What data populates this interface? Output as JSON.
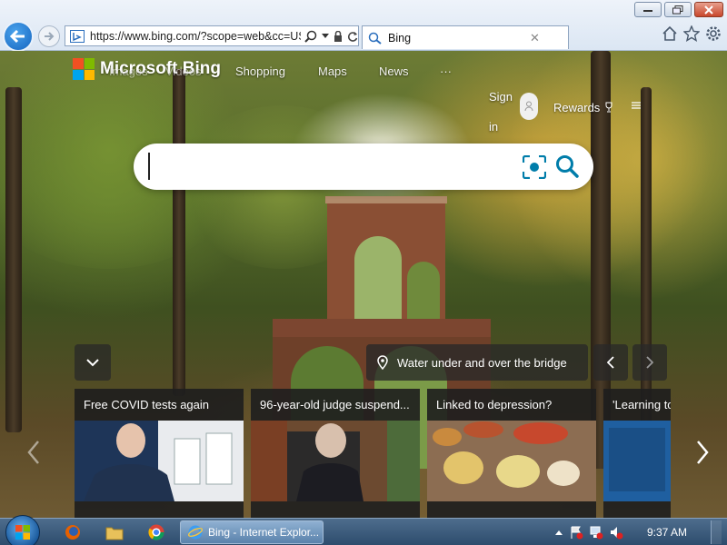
{
  "browser": {
    "url": "https://www.bing.com/?scope=web&cc=US&toHttps=1&redig=",
    "tab_title": "Bing",
    "tab_close": "✕"
  },
  "bing": {
    "logo_text": "Microsoft Bing",
    "nav": [
      "Images",
      "Videos",
      "Shopping",
      "Maps",
      "News",
      "···"
    ],
    "sign_in": "Sign in",
    "rewards": "Rewards",
    "search_placeholder": "",
    "image_caption": "Water under and over the bridge",
    "cards": [
      {
        "title": "Free COVID tests again"
      },
      {
        "title": "96-year-old judge suspend..."
      },
      {
        "title": "Linked to depression?"
      },
      {
        "title": "'Learning to"
      }
    ]
  },
  "taskbar": {
    "active_window": "Bing - Internet Explor...",
    "clock": "9:37 AM"
  },
  "colors": {
    "ie_blue": "#1565c0",
    "bing_accent": "#007daa",
    "taskbar": "#2d4c6d"
  }
}
